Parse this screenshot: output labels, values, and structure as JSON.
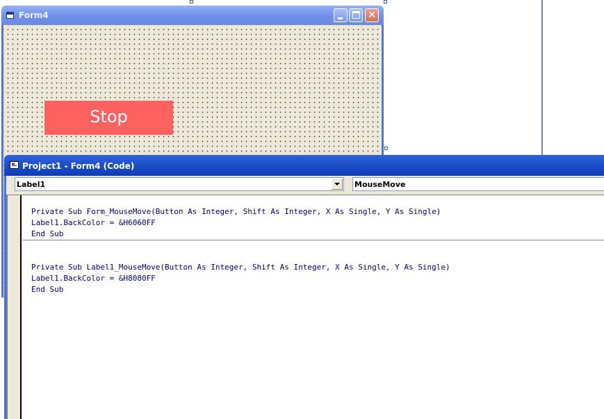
{
  "form_window": {
    "title": "Form4",
    "label_text": "Stop",
    "label_color": "#FF6060"
  },
  "code_window": {
    "title": "Project1 - Form4 (Code)",
    "object_combo": "Label1",
    "procedure_combo": "MouseMove",
    "lines": [
      "Private Sub Form_MouseMove(Button As Integer, Shift As Integer, X As Single, Y As Single)",
      "Label1.BackColor = &H6060FF",
      "End Sub",
      "Private Sub Label1_MouseMove(Button As Integer, Shift As Integer, X As Single, Y As Single)",
      "Label1.BackColor = &H8080FF",
      "End Sub"
    ]
  },
  "colors": {
    "code_text": "#000080",
    "titlebar_active": "#0a3db7",
    "titlebar_inactive": "#7a96e6"
  }
}
